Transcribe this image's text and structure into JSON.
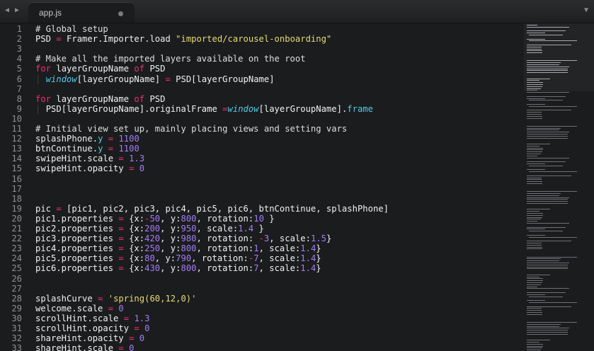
{
  "tabs": {
    "back_icon": "◀",
    "forward_icon": "▶",
    "active_title": "app.js",
    "menu_icon": "▼"
  },
  "editor": {
    "lines": [
      {
        "n": "1",
        "t": [
          [
            "c",
            "# Global setup"
          ]
        ]
      },
      {
        "n": "2",
        "t": [
          [
            "",
            "PSD "
          ],
          [
            "k",
            "="
          ],
          [
            "",
            " Framer.Importer.load "
          ],
          [
            "s",
            "\"imported/carousel-onboarding\""
          ]
        ]
      },
      {
        "n": "3",
        "t": []
      },
      {
        "n": "4",
        "t": [
          [
            "c",
            "# Make all the imported layers available on the root"
          ]
        ]
      },
      {
        "n": "5",
        "t": [
          [
            "k",
            "for"
          ],
          [
            "",
            " layerGroupName "
          ],
          [
            "k",
            "of"
          ],
          [
            "",
            " PSD"
          ]
        ]
      },
      {
        "n": "6",
        "t": [
          [
            "g",
            "| "
          ],
          [
            "i",
            "window"
          ],
          [
            "",
            "[layerGroupName] "
          ],
          [
            "k",
            "="
          ],
          [
            "",
            " PSD[layerGroupName]"
          ]
        ]
      },
      {
        "n": "7",
        "t": []
      },
      {
        "n": "8",
        "t": [
          [
            "k",
            "for"
          ],
          [
            "",
            " layerGroupName "
          ],
          [
            "k",
            "of"
          ],
          [
            "",
            " PSD"
          ]
        ]
      },
      {
        "n": "9",
        "t": [
          [
            "g",
            "| "
          ],
          [
            "",
            "PSD[layerGroupName].originalFrame "
          ],
          [
            "k",
            "="
          ],
          [
            " ",
            ""
          ],
          [
            "i",
            "window"
          ],
          [
            "",
            "[layerGroupName]."
          ],
          [
            "p",
            "frame"
          ]
        ]
      },
      {
        "n": "10",
        "t": []
      },
      {
        "n": "11",
        "t": [
          [
            "c",
            "# Initial view set up, mainly placing views and setting vars"
          ]
        ]
      },
      {
        "n": "12",
        "t": [
          [
            "",
            "splashPhone."
          ],
          [
            "p",
            "y"
          ],
          [
            "",
            " "
          ],
          [
            "k",
            "="
          ],
          [
            "",
            " "
          ],
          [
            "n",
            "1100"
          ]
        ]
      },
      {
        "n": "13",
        "t": [
          [
            "",
            "btnContinue."
          ],
          [
            "p",
            "y"
          ],
          [
            "",
            " "
          ],
          [
            "k",
            "="
          ],
          [
            "",
            " "
          ],
          [
            "n",
            "1100"
          ]
        ]
      },
      {
        "n": "14",
        "t": [
          [
            "",
            "swipeHint.scale "
          ],
          [
            "k",
            "="
          ],
          [
            "",
            " "
          ],
          [
            "n",
            "1.3"
          ]
        ]
      },
      {
        "n": "15",
        "t": [
          [
            "",
            "swipeHint.opacity "
          ],
          [
            "k",
            "="
          ],
          [
            "",
            " "
          ],
          [
            "n",
            "0"
          ]
        ]
      },
      {
        "n": "16",
        "t": []
      },
      {
        "n": "17",
        "t": []
      },
      {
        "n": "18",
        "t": []
      },
      {
        "n": "19",
        "t": [
          [
            "",
            "pic "
          ],
          [
            "k",
            "="
          ],
          [
            "",
            " [pic1, pic2, pic3, pic4, pic5, pic6, btnContinue, splashPhone]"
          ]
        ]
      },
      {
        "n": "20",
        "t": [
          [
            "",
            "pic1.properties "
          ],
          [
            "k",
            "="
          ],
          [
            "",
            " {x:"
          ],
          [
            "k",
            "-"
          ],
          [
            "n",
            "50"
          ],
          [
            "",
            ", y:"
          ],
          [
            "n",
            "800"
          ],
          [
            "",
            ", rotation:"
          ],
          [
            "n",
            "10"
          ],
          [
            "",
            " }"
          ]
        ]
      },
      {
        "n": "21",
        "t": [
          [
            "",
            "pic2.properties "
          ],
          [
            "k",
            "="
          ],
          [
            "",
            " {x:"
          ],
          [
            "n",
            "200"
          ],
          [
            "",
            ", y:"
          ],
          [
            "n",
            "950"
          ],
          [
            "",
            ", scale:"
          ],
          [
            "n",
            "1.4"
          ],
          [
            "",
            " }"
          ]
        ]
      },
      {
        "n": "22",
        "t": [
          [
            "",
            "pic3.properties "
          ],
          [
            "k",
            "="
          ],
          [
            "",
            " {x:"
          ],
          [
            "n",
            "420"
          ],
          [
            "",
            ", y:"
          ],
          [
            "n",
            "980"
          ],
          [
            "",
            ", rotation: "
          ],
          [
            "k",
            "-"
          ],
          [
            "n",
            "3"
          ],
          [
            "",
            ", scale:"
          ],
          [
            "n",
            "1.5"
          ],
          [
            "",
            "}"
          ]
        ]
      },
      {
        "n": "23",
        "t": [
          [
            "",
            "pic4.properties "
          ],
          [
            "k",
            "="
          ],
          [
            "",
            " {x:"
          ],
          [
            "n",
            "250"
          ],
          [
            "",
            ", y:"
          ],
          [
            "n",
            "800"
          ],
          [
            "",
            ", rotation:"
          ],
          [
            "n",
            "1"
          ],
          [
            "",
            ", scale:"
          ],
          [
            "n",
            "1.4"
          ],
          [
            "",
            "}"
          ]
        ]
      },
      {
        "n": "24",
        "t": [
          [
            "",
            "pic5.properties "
          ],
          [
            "k",
            "="
          ],
          [
            "",
            " {x:"
          ],
          [
            "n",
            "80"
          ],
          [
            "",
            ", y:"
          ],
          [
            "n",
            "790"
          ],
          [
            "",
            ", rotation:"
          ],
          [
            "k",
            "-"
          ],
          [
            "n",
            "7"
          ],
          [
            "",
            ", scale:"
          ],
          [
            "n",
            "1.4"
          ],
          [
            "",
            "}"
          ]
        ]
      },
      {
        "n": "25",
        "t": [
          [
            "",
            "pic6.properties "
          ],
          [
            "k",
            "="
          ],
          [
            "",
            " {x:"
          ],
          [
            "n",
            "430"
          ],
          [
            "",
            ", y:"
          ],
          [
            "n",
            "800"
          ],
          [
            "",
            ", rotation:"
          ],
          [
            "n",
            "7"
          ],
          [
            "",
            ", scale:"
          ],
          [
            "n",
            "1.4"
          ],
          [
            "",
            "}"
          ]
        ]
      },
      {
        "n": "26",
        "t": []
      },
      {
        "n": "27",
        "t": []
      },
      {
        "n": "28",
        "t": [
          [
            "",
            "splashCurve "
          ],
          [
            "k",
            "="
          ],
          [
            "",
            " "
          ],
          [
            "s",
            "'spring(60,12,0)'"
          ]
        ]
      },
      {
        "n": "29",
        "t": [
          [
            "",
            "welcome.scale "
          ],
          [
            "k",
            "="
          ],
          [
            "",
            " "
          ],
          [
            "n",
            "0"
          ]
        ]
      },
      {
        "n": "30",
        "t": [
          [
            "",
            "scrollHint.scale "
          ],
          [
            "k",
            "="
          ],
          [
            "",
            " "
          ],
          [
            "n",
            "1.3"
          ]
        ]
      },
      {
        "n": "31",
        "t": [
          [
            "",
            "scrollHint.opacity "
          ],
          [
            "k",
            "="
          ],
          [
            "",
            " "
          ],
          [
            "n",
            "0"
          ]
        ]
      },
      {
        "n": "32",
        "t": [
          [
            "",
            "shareHint.opacity "
          ],
          [
            "k",
            "="
          ],
          [
            "",
            " "
          ],
          [
            "n",
            "0"
          ]
        ]
      },
      {
        "n": "33",
        "t": [
          [
            "",
            "shareHint.scale "
          ],
          [
            "k",
            "="
          ],
          [
            "",
            " "
          ],
          [
            "n",
            "0"
          ]
        ]
      }
    ]
  }
}
